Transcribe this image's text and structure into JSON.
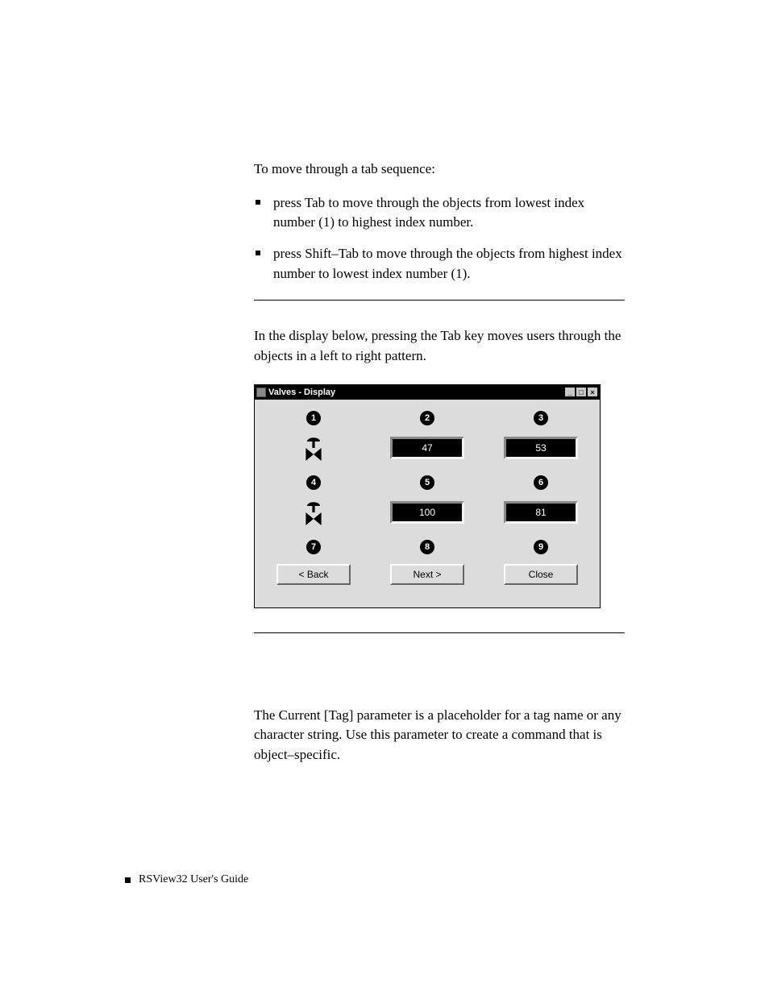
{
  "paragraphs": {
    "intro": "To move through a tab sequence:",
    "bullet1": "press Tab to move through the objects from lowest index number (1) to highest index number.",
    "bullet2": "press Shift–Tab to move through the objects from highest index number to lowest index number (1).",
    "mid": "In the display below, pressing the Tab key moves users through the objects in a left to right pattern.",
    "bottom": "The Current [Tag] parameter is a placeholder for a tag name or any character string. Use this parameter to create a command that is object–specific."
  },
  "dialog": {
    "title": "Valves - Display",
    "titlebar": {
      "minimize": "_",
      "maximize": "□",
      "close": "×"
    },
    "badges": {
      "b1": "1",
      "b2": "2",
      "b3": "3",
      "b4": "4",
      "b5": "5",
      "b6": "6",
      "b7": "7",
      "b8": "8",
      "b9": "9"
    },
    "values": {
      "v2": "47",
      "v3": "53",
      "v5": "100",
      "v6": "81"
    },
    "buttons": {
      "back": "<  Back",
      "next": "Next  >",
      "close": "Close"
    }
  },
  "footer": "RSView32  User's Guide"
}
